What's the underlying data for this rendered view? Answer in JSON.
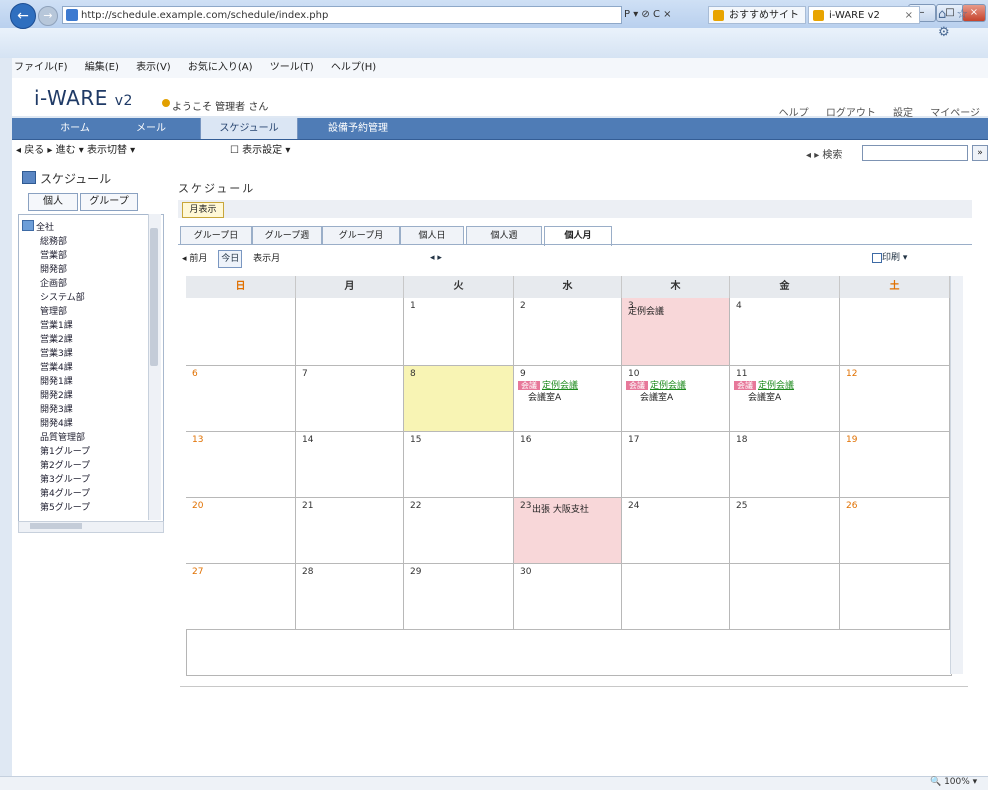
{
  "browser": {
    "address": "http://schedule.example.com/schedule/index.php",
    "address_tools": "P ▾ ⊘ C ×",
    "tab1_title": "おすすめサイト",
    "tab2_title": "i-WARE v2",
    "tab_close": "×",
    "icons": "⌂ ☆ ⚙",
    "window_buttons": [
      "–",
      "□",
      "×"
    ],
    "menu": [
      "ファイル(F)",
      "編集(E)",
      "表示(V)",
      "お気に入り(A)",
      "ツール(T)",
      "ヘルプ(H)"
    ],
    "zoom": "🔍 100% ▾"
  },
  "app": {
    "logo": "i-WARE",
    "logo_ver": "v2",
    "welcome": "ようこそ 管理者 さん",
    "header_links": "ヘルプ  ログアウト  設定  マイページ",
    "nav": [
      "ホーム",
      "メール",
      "スケジュール",
      "設備予約管理"
    ],
    "toolrow_left": "◂ 戻る   ▸ 進む ▾ 表示切替 ▾",
    "toolrow_mid": "☐ 表示設定 ▾",
    "search_label": "◂ ▸ 検索",
    "search_btn": "»"
  },
  "sidebar": {
    "title": "スケジュール",
    "tab1": "個人",
    "tab2": "グループ",
    "tree": [
      "全社",
      "総務部",
      "営業部",
      "開発部",
      "企画部",
      "システム部",
      "管理部",
      "営業1課",
      "営業2課",
      "営業3課",
      "営業4課",
      "開発1課",
      "開発2課",
      "開発3課",
      "開発4課",
      "品質管理部",
      "第1グループ",
      "第2グループ",
      "第3グループ",
      "第4グループ",
      "第5グループ"
    ]
  },
  "main": {
    "title": "スケジュール",
    "subtitle_badge": "月表示",
    "view_tabs": [
      "グループ日",
      "グループ週",
      "グループ月",
      "個人日",
      "個人週",
      "個人月"
    ],
    "ctrl_left": "◂ 前月",
    "ctrl_today": "今日",
    "ctrl_label": "表示月",
    "month_nav": "◂ ▸",
    "print_link": "印刷 ▾",
    "weekdays": [
      "日",
      "月",
      "火",
      "水",
      "木",
      "金",
      "土"
    ],
    "rows": [
      [
        "",
        "",
        "1",
        "2",
        "3",
        "4",
        ""
      ],
      [
        "6",
        "7",
        "8",
        "9",
        "10",
        "11",
        "12"
      ],
      [
        "13",
        "14",
        "15",
        "16",
        "17",
        "18",
        "19"
      ],
      [
        "20",
        "21",
        "22",
        "23",
        "24",
        "25",
        "26"
      ],
      [
        "27",
        "28",
        "29",
        "30",
        "",
        "",
        ""
      ]
    ],
    "events": {
      "e1": "定例会議",
      "e2_tag": "会議",
      "e2_title": "定例会議",
      "e2_sub": "会議室A",
      "e3_tag": "会議",
      "e3_title": "定例会議",
      "e3_sub": "会議室A",
      "e4_tag": "会議",
      "e4_title": "定例会議",
      "e4_sub": "会議室A",
      "e5": "出張 大阪支社"
    }
  }
}
